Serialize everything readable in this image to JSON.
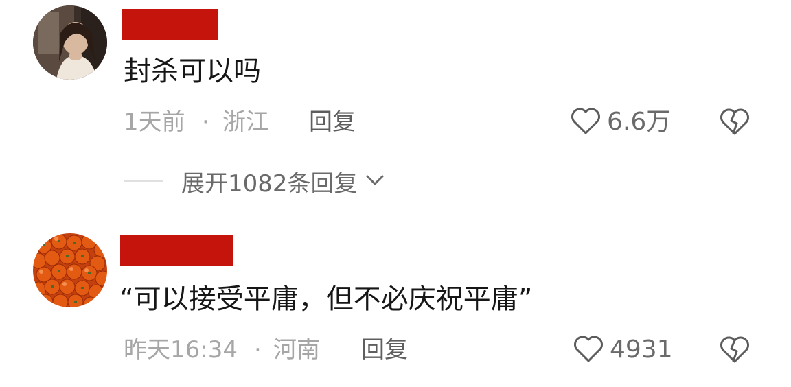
{
  "comments": [
    {
      "username_redacted": true,
      "text": "封杀可以吗",
      "time": "1天前",
      "separator": "·",
      "location": "浙江",
      "reply_label": "回复",
      "likes": "6.6万",
      "expand_label": "展开1082条回复"
    },
    {
      "username_redacted": true,
      "text": "“可以接受平庸，但不必庆祝平庸”",
      "time": "昨天16:34",
      "separator": "·",
      "location": "河南",
      "reply_label": "回复",
      "likes": "4931"
    }
  ],
  "colors": {
    "redaction": "#c4140c",
    "text_primary": "#161616",
    "text_meta": "#a6a6a6",
    "text_action": "#5e5e5e"
  },
  "icons": {
    "like": "heart-outline-icon",
    "dislike": "broken-heart-icon",
    "expand": "chevron-down-icon"
  }
}
